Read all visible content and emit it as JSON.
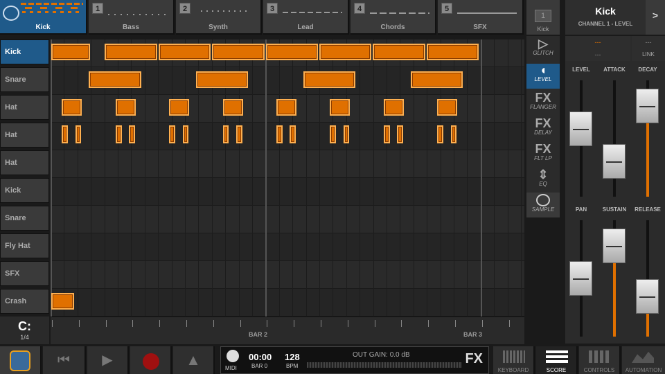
{
  "tracks": [
    {
      "num": "",
      "name": "Kick"
    },
    {
      "num": "1",
      "name": "Bass"
    },
    {
      "num": "2",
      "name": "Synth"
    },
    {
      "num": "3",
      "name": "Lead"
    },
    {
      "num": "4",
      "name": "Chords"
    },
    {
      "num": "5",
      "name": "SFX"
    }
  ],
  "channel": {
    "badge": "1",
    "badge_label": "Kick",
    "title": "Kick",
    "subtitle": "CHANNEL 1 - LEVEL",
    "next": ">"
  },
  "instruments": [
    "Kick",
    "Snare",
    "Hat",
    "Hat",
    "Hat",
    "Kick",
    "Snare",
    "Fly Hat",
    "SFX",
    "Crash"
  ],
  "quantize": {
    "glyph": "C:",
    "value": "1/4"
  },
  "ruler": {
    "bar2": "BAR 2",
    "bar3": "BAR 3"
  },
  "fx": [
    {
      "big": "",
      "small": "GLITCH"
    },
    {
      "big": "",
      "small": "LEVEL"
    },
    {
      "big": "FX",
      "small": "FLANGER"
    },
    {
      "big": "FX",
      "small": "DELAY"
    },
    {
      "big": "FX",
      "small": "FLT LP"
    },
    {
      "big": "",
      "small": "EQ"
    },
    {
      "big": "",
      "small": "SAMPLE"
    }
  ],
  "link": {
    "left_top": "---",
    "left_bot": "---",
    "right_top": "---",
    "right_bot": "LINK"
  },
  "sliders": [
    {
      "label": "LEVEL",
      "level": 0.62
    },
    {
      "label": "ATTACK",
      "level": 0.22
    },
    {
      "label": "DECAY",
      "level": 0.9
    },
    {
      "label": "PAN",
      "level": 0.5
    },
    {
      "label": "SUSTAIN",
      "level": 0.9
    },
    {
      "label": "RELEASE",
      "level": 0.28
    }
  ],
  "transport": {
    "time": "00:00",
    "bar": "BAR 0",
    "bpm_val": "128",
    "bpm_lbl": "BPM",
    "midi": "MIDI",
    "gain": "OUT GAIN: 0.0 dB",
    "fx": "FX"
  },
  "views": [
    {
      "label": "KEYBOARD"
    },
    {
      "label": "SCORE"
    },
    {
      "label": "CONTROLS"
    },
    {
      "label": "AUTOMATION"
    }
  ],
  "colors": {
    "accent": "#e07000",
    "select": "#1f5a8a"
  }
}
